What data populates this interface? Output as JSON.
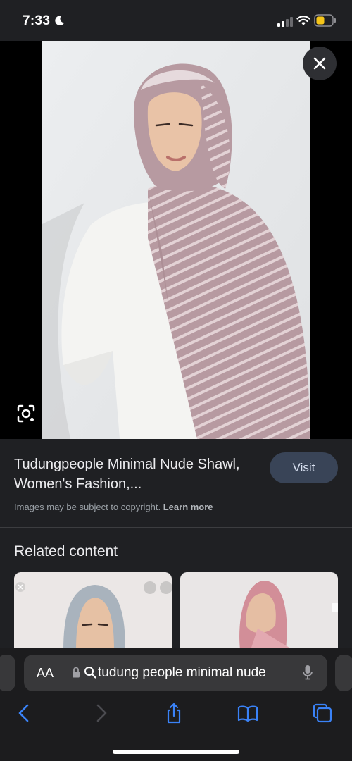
{
  "status": {
    "time": "7:33"
  },
  "result": {
    "title": "Tudungpeople Minimal Nude Shawl, Women's Fashion,...",
    "visit_label": "Visit",
    "copyright_text": "Images may be subject to copyright.",
    "learn_more_label": "Learn more"
  },
  "related": {
    "title": "Related content"
  },
  "browser": {
    "aa_label": "AA",
    "url_text": "tudung people minimal nude"
  },
  "colors": {
    "background": "#1f2023",
    "visit_button": "#394457",
    "toolbar_accent": "#3a82f7"
  },
  "icons": [
    "moon-icon",
    "signal-icon",
    "wifi-icon",
    "battery-icon",
    "close-icon",
    "lens-icon",
    "lock-icon",
    "search-icon",
    "microphone-icon",
    "back-icon",
    "forward-icon",
    "share-icon",
    "bookmarks-icon",
    "tabs-icon"
  ]
}
